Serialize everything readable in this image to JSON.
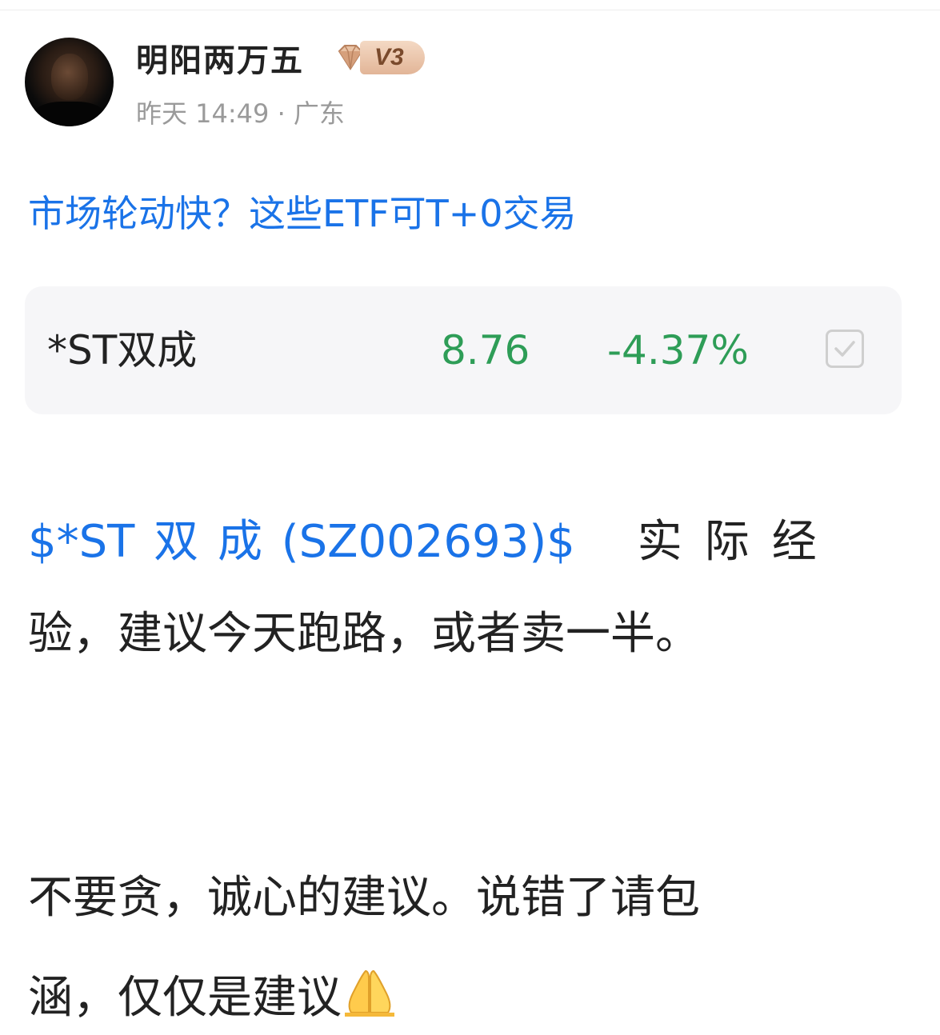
{
  "header": {
    "username": "明阳两万五",
    "level": "V3",
    "time": "昨天 14:49",
    "separator": "·",
    "location": "广东"
  },
  "topic": {
    "text": "市场轮动快？这些ETF可T+0交易"
  },
  "stock_card": {
    "name": "*ST双成",
    "price": "8.76",
    "change": "-4.37%",
    "change_color": "#2e9d57"
  },
  "post": {
    "mention": "$*ST 双 成 (SZ002693)$",
    "line1_rest": "实际经",
    "line2": "验，建议今天跑路，或者卖一半。",
    "line3": "不要贪，诚心的建议。说错了请包",
    "line4": "涵，仅仅是建议",
    "emoji": "praying-hands-emoji"
  },
  "colors": {
    "link": "#1a73e8",
    "text": "#222222",
    "meta": "#9a9a9a",
    "card_bg": "#f6f6f8"
  }
}
